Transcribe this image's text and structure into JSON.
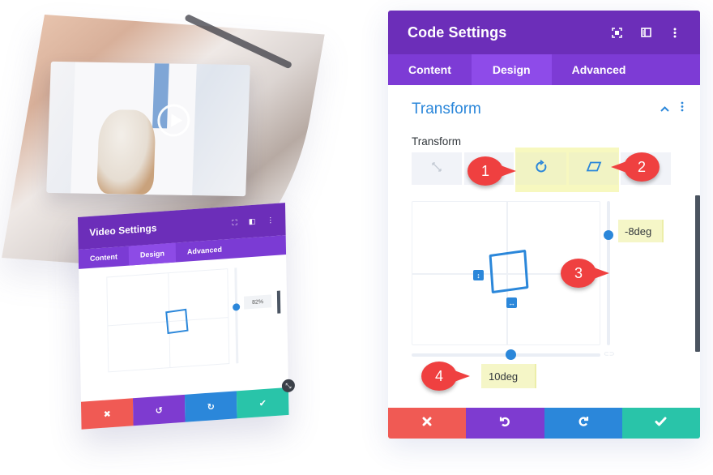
{
  "background_scene": {
    "video_thumbnail": "veterinarian-with-bulldog",
    "play_icon": "play-circle-icon",
    "mini_modal": {
      "title": "Video Settings",
      "header_icons": [
        "expand-icon",
        "sidebar-icon",
        "more-vertical-icon"
      ],
      "tabs": [
        {
          "label": "Content",
          "active": false
        },
        {
          "label": "Design",
          "active": true
        },
        {
          "label": "Advanced",
          "active": false
        }
      ],
      "value": "82%",
      "footer": [
        {
          "icon": "close-icon",
          "glyph": "✖",
          "color": "#f05a54"
        },
        {
          "icon": "undo-icon",
          "glyph": "↺",
          "color": "#7e3bd0"
        },
        {
          "icon": "redo-icon",
          "glyph": "↻",
          "color": "#2b87da"
        },
        {
          "icon": "check-icon",
          "glyph": "✔",
          "color": "#29c4a9"
        }
      ],
      "resize_glyph": "⤡"
    }
  },
  "modal": {
    "title": "Code Settings",
    "header_icons": {
      "expand": "expand-icon",
      "sidebar": "sidebar-icon",
      "more": "more-vertical-icon"
    },
    "tabs": [
      {
        "label": "Content",
        "active": false
      },
      {
        "label": "Design",
        "active": true
      },
      {
        "label": "Advanced",
        "active": false
      }
    ],
    "section": {
      "title": "Transform",
      "collapse_glyph": "^",
      "more_glyph": "⋮"
    },
    "field_label": "Transform",
    "transform_tools": [
      {
        "name": "scale",
        "icon": "scale-icon",
        "selected": false
      },
      {
        "name": "translate",
        "icon": "move-icon",
        "selected": false
      },
      {
        "name": "rotate",
        "icon": "rotate-icon",
        "selected": true
      },
      {
        "name": "skew",
        "icon": "skew-icon",
        "selected": true
      },
      {
        "name": "origin",
        "icon": "origin-icon",
        "selected": false
      }
    ],
    "skew_x": "10deg",
    "skew_y": "-8deg",
    "hint_v_glyph": "↕",
    "hint_h_glyph": "↔",
    "link_glyph": "⊂⊃",
    "footer": [
      {
        "name": "discard",
        "icon": "close-icon",
        "color": "#f05a54"
      },
      {
        "name": "undo",
        "icon": "undo-icon",
        "color": "#7e3bd0"
      },
      {
        "name": "redo",
        "icon": "redo-icon",
        "color": "#2b87da"
      },
      {
        "name": "save",
        "icon": "check-icon",
        "color": "#29c4a9"
      }
    ]
  },
  "annotations": [
    {
      "number": "1",
      "target": "rotate-tool"
    },
    {
      "number": "2",
      "target": "skew-tool"
    },
    {
      "number": "3",
      "target": "skew-y-slider"
    },
    {
      "number": "4",
      "target": "skew-x-slider"
    }
  ],
  "colors": {
    "header_purple": "#6c2eb9",
    "tab_purple": "#7d3bd5",
    "tab_active": "#8e4be9",
    "accent_blue": "#2b87da",
    "highlight_yellow": "#f5f6c7",
    "pin_red": "#ef4040"
  }
}
